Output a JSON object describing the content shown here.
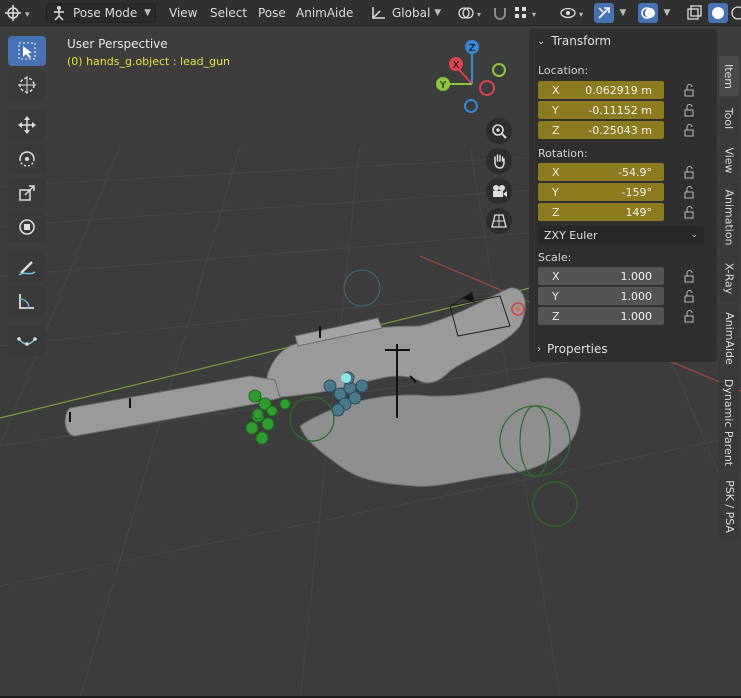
{
  "header": {
    "mode": "Pose Mode",
    "menus": [
      "View",
      "Select",
      "Pose",
      "AnimAide"
    ],
    "orientation": "Global",
    "icons": [
      "editor-type-icon",
      "pose-mode-icon",
      "transform-orientation-icon",
      "pivot-icon",
      "snap-icon",
      "proportional-icon",
      "visibility-icon",
      "gizmo-icon",
      "overlay-icon",
      "xray-icon",
      "shading-solid-icon"
    ]
  },
  "viewport": {
    "title": "User Perspective",
    "object_label": "(0) hands_g.object : lead_gun"
  },
  "toolbar": {
    "tools": [
      "select-box-icon",
      "cursor-icon",
      "move-icon",
      "rotate-icon",
      "scale-icon",
      "transform-icon",
      "annotate-icon",
      "measure-icon",
      "relax-pose-icon"
    ]
  },
  "navigation": {
    "axes": {
      "x": "X",
      "y": "Y",
      "z": "Z"
    },
    "buttons": [
      "zoom-icon",
      "pan-hand-icon",
      "camera-icon",
      "perspective-grid-icon"
    ]
  },
  "npanel": {
    "transform_title": "Transform",
    "location_label": "Location:",
    "location": [
      {
        "axis": "X",
        "value": "0.062919 m"
      },
      {
        "axis": "Y",
        "value": "-0.11152 m"
      },
      {
        "axis": "Z",
        "value": "-0.25043 m"
      }
    ],
    "rotation_label": "Rotation:",
    "rotation": [
      {
        "axis": "X",
        "value": "-54.9°"
      },
      {
        "axis": "Y",
        "value": "-159°"
      },
      {
        "axis": "Z",
        "value": "149°"
      }
    ],
    "rotation_mode": "ZXY Euler",
    "scale_label": "Scale:",
    "scale": [
      {
        "axis": "X",
        "value": "1.000"
      },
      {
        "axis": "Y",
        "value": "1.000"
      },
      {
        "axis": "Z",
        "value": "1.000"
      }
    ],
    "properties_title": "Properties"
  },
  "tabs": [
    "Item",
    "Tool",
    "View",
    "Animation",
    "X-Ray",
    "AnimAide",
    "Dynamic Parent",
    "PSK / PSA"
  ],
  "colors": {
    "keyed_field": "#8c7b1f",
    "x_axis": "#e0444e",
    "y_axis": "#8cc63e",
    "z_axis": "#3a87d9",
    "active": "#4772b3"
  }
}
